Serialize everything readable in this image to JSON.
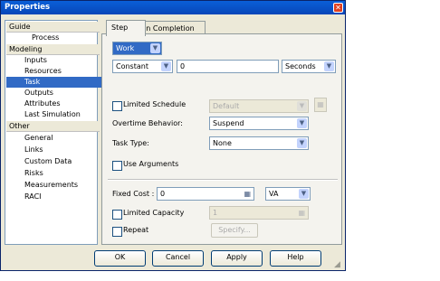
{
  "window": {
    "title": "Properties"
  },
  "nav": {
    "sections": [
      {
        "label": "Guide",
        "items": [
          {
            "label": "Process"
          }
        ]
      },
      {
        "label": "Modeling",
        "items": [
          {
            "label": "Inputs"
          },
          {
            "label": "Resources"
          },
          {
            "label": "Task",
            "selected": true
          },
          {
            "label": "Outputs"
          },
          {
            "label": "Attributes"
          },
          {
            "label": "Last Simulation"
          }
        ]
      },
      {
        "label": "Other",
        "items": [
          {
            "label": "General"
          },
          {
            "label": "Links"
          },
          {
            "label": "Custom Data"
          },
          {
            "label": "Risks"
          },
          {
            "label": "Measurements"
          },
          {
            "label": "RACI"
          }
        ]
      }
    ]
  },
  "tabs": [
    {
      "label": "Step"
    },
    {
      "label": "On Completion"
    }
  ],
  "step": {
    "type_value": "Work",
    "duration_mode": "Constant",
    "duration_value": "0",
    "duration_unit": "Seconds",
    "limited_schedule_label": "Limited Schedule",
    "schedule_value": "Default",
    "overtime_label": "Overtime Behavior:",
    "overtime_value": "Suspend",
    "task_type_label": "Task Type:",
    "task_type_value": "None",
    "use_arguments_label": "Use Arguments",
    "fixed_cost_label": "Fixed Cost :",
    "fixed_cost_value": "0",
    "fixed_cost_unit": "VA",
    "limited_capacity_label": "Limited Capacity",
    "capacity_value": "1",
    "repeat_label": "Repeat",
    "specify_label": "Specify..."
  },
  "buttons": {
    "ok": "OK",
    "cancel": "Cancel",
    "apply": "Apply",
    "help": "Help"
  },
  "colors": {
    "title_bar": "#0846b8",
    "selection": "#316ac5"
  }
}
